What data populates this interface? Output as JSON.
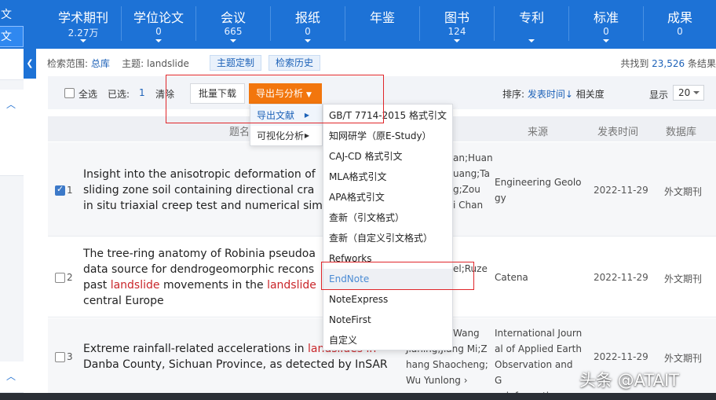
{
  "sidebar": {
    "items": [
      {
        "label": "文"
      },
      {
        "label": "文"
      }
    ]
  },
  "nav": {
    "tabs": [
      {
        "label": "学术期刊",
        "count": "2.27万"
      },
      {
        "label": "学位论文",
        "count": "0"
      },
      {
        "label": "会议",
        "count": "665"
      },
      {
        "label": "报纸",
        "count": "0"
      },
      {
        "label": "年鉴",
        "count": ""
      },
      {
        "label": "图书",
        "count": "124"
      },
      {
        "label": "专利",
        "count": ""
      },
      {
        "label": "标准",
        "count": "0"
      },
      {
        "label": "成果",
        "count": "0"
      }
    ]
  },
  "scope": {
    "range_label": "检索范围:",
    "range_value": "总库",
    "topic_label": "主题:",
    "topic_value": "landslide",
    "topic_custom": "主题定制",
    "history": "检索历史",
    "found_prefix": "共找到",
    "found_count": "23,526",
    "found_suffix": "条结果"
  },
  "toolbar": {
    "select_all": "全选",
    "selected_label": "已选:",
    "selected_count": "1",
    "clear": "清除",
    "batch_download": "批量下载",
    "export_analysis": "导出与分析",
    "sort_label": "排序:",
    "sort_publish": "发表时间↓",
    "sort_relevance": "相关度",
    "show_label": "显示",
    "page_size": "20"
  },
  "table": {
    "headers": {
      "title": "题名",
      "author": "作者",
      "source": "来源",
      "date": "发表时间",
      "db": "数据库"
    },
    "rows": [
      {
        "index": "1",
        "checked": true,
        "title_lines": [
          "Insight into the anisotropic deformation of",
          "sliding zone soil containing directional cra",
          "in situ triaxial creep test and numerical sim"
        ],
        "author_lines": [
          "an;Huan",
          "uang;Ta",
          "g;Zou",
          "i Chan"
        ],
        "source_lines": [
          "Engineering Geolo",
          "gy"
        ],
        "date": "2022-11-29",
        "db": "外文期刊"
      },
      {
        "index": "2",
        "checked": false,
        "title_line1": "The tree-ring anatomy of Robinia pseudoa",
        "title_line2": "data source for dendrogeomorphic recons",
        "title_line3_pre": "past ",
        "title_line3_hl1": "landslide",
        "title_line3_mid": " movements in the ",
        "title_line3_hl2": "landslide",
        "title_line4": "central Europe",
        "author_lines": [
          "el;Ruze"
        ],
        "source_lines": [
          "Catena"
        ],
        "date": "2022-11-29",
        "db": "外文期刊"
      },
      {
        "index": "3",
        "checked": false,
        "title_line1_pre": "Extreme rainfall-related accelerations in ",
        "title_line1_hl": "landslides in",
        "title_line2": "Danba County, Sichuan Province, as detected by InSAR",
        "author_lines": [
          "Wang",
          "Jianing;Jiang Mi;Z",
          "hang Shaocheng;",
          "Wu Yunlong ›"
        ],
        "source_lines": [
          "International Journ",
          "al of Applied Earth",
          "Observation and G",
          "eoinformation"
        ],
        "date": "2022-11-29",
        "db": "外文期刊"
      }
    ]
  },
  "menu": {
    "level1": [
      {
        "label": "导出文献"
      },
      {
        "label": "可视化分析"
      }
    ],
    "level2": [
      {
        "label": "GB/T 7714-2015 格式引文"
      },
      {
        "label": "知网研学（原E-Study）"
      },
      {
        "label": "CAJ-CD 格式引文"
      },
      {
        "label": "MLA格式引文"
      },
      {
        "label": "APA格式引文"
      },
      {
        "label": "查新（引文格式）"
      },
      {
        "label": "查新（自定义引文格式）"
      },
      {
        "label": "Refworks"
      },
      {
        "label": "EndNote"
      },
      {
        "label": "NoteExpress"
      },
      {
        "label": "NoteFirst"
      },
      {
        "label": "自定义"
      }
    ]
  },
  "watermark": "头条 @ATAIT"
}
